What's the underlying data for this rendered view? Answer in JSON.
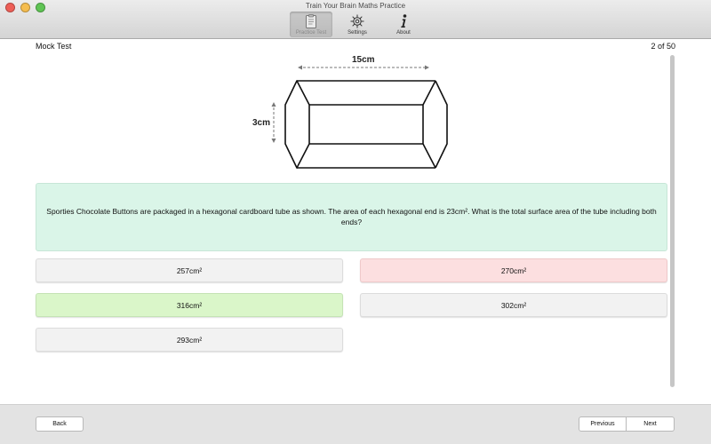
{
  "window": {
    "title": "Train Your Brain Maths Practice"
  },
  "toolbar": {
    "items": [
      {
        "label": "Practice Test",
        "icon": "clipboard-icon",
        "active": true
      },
      {
        "label": "Settings",
        "icon": "gear-icon",
        "active": false
      },
      {
        "label": "About",
        "icon": "info-icon",
        "active": false
      }
    ]
  },
  "header": {
    "title": "Mock Test",
    "counter": "2 of 50"
  },
  "figure": {
    "length_label": "15cm",
    "side_label": "3cm"
  },
  "question": {
    "text": "Sporties Chocolate Buttons are packaged in a hexagonal cardboard tube as shown. The area of each hexagonal end is 23cm². What is the total surface area of the tube including both ends?"
  },
  "answers": [
    {
      "label": "257cm²",
      "state": "neutral"
    },
    {
      "label": "270cm²",
      "state": "wrong"
    },
    {
      "label": "316cm²",
      "state": "correct"
    },
    {
      "label": "302cm²",
      "state": "neutral"
    },
    {
      "label": "293cm²",
      "state": "neutral"
    }
  ],
  "footer": {
    "back_label": "Back",
    "previous_label": "Previous",
    "next_label": "Next"
  },
  "colors": {
    "question_bg": "#daf5e8",
    "correct_bg": "#daf6c9",
    "wrong_bg": "#fcdfe0",
    "neutral_bg": "#f2f2f2"
  }
}
